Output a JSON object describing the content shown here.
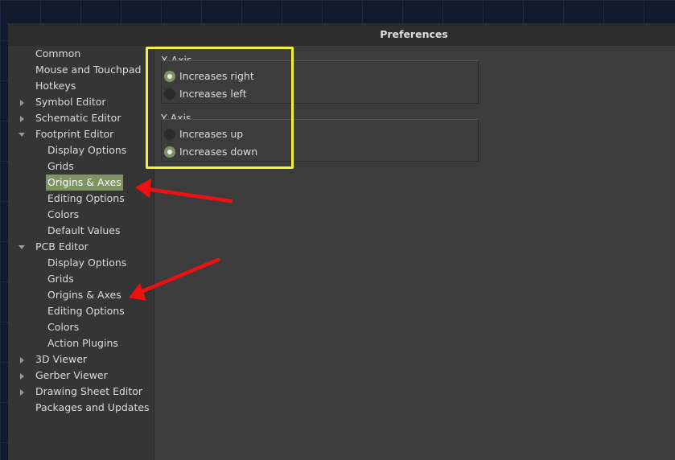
{
  "window": {
    "title": "Preferences"
  },
  "sidebar": {
    "items": [
      {
        "label": "Common",
        "level": 0,
        "expander": "none"
      },
      {
        "label": "Mouse and Touchpad",
        "level": 0,
        "expander": "none"
      },
      {
        "label": "Hotkeys",
        "level": 0,
        "expander": "none"
      },
      {
        "label": "Symbol Editor",
        "level": 0,
        "expander": "collapsed"
      },
      {
        "label": "Schematic Editor",
        "level": 0,
        "expander": "collapsed"
      },
      {
        "label": "Footprint Editor",
        "level": 0,
        "expander": "expanded"
      },
      {
        "label": "Display Options",
        "level": 1,
        "expander": "none"
      },
      {
        "label": "Grids",
        "level": 1,
        "expander": "none"
      },
      {
        "label": "Origins & Axes",
        "level": 1,
        "expander": "none",
        "selected": true
      },
      {
        "label": "Editing Options",
        "level": 1,
        "expander": "none"
      },
      {
        "label": "Colors",
        "level": 1,
        "expander": "none"
      },
      {
        "label": "Default Values",
        "level": 1,
        "expander": "none"
      },
      {
        "label": "PCB Editor",
        "level": 0,
        "expander": "expanded"
      },
      {
        "label": "Display Options",
        "level": 1,
        "expander": "none"
      },
      {
        "label": "Grids",
        "level": 1,
        "expander": "none"
      },
      {
        "label": "Origins & Axes",
        "level": 1,
        "expander": "none"
      },
      {
        "label": "Editing Options",
        "level": 1,
        "expander": "none"
      },
      {
        "label": "Colors",
        "level": 1,
        "expander": "none"
      },
      {
        "label": "Action Plugins",
        "level": 1,
        "expander": "none"
      },
      {
        "label": "3D Viewer",
        "level": 0,
        "expander": "collapsed"
      },
      {
        "label": "Gerber Viewer",
        "level": 0,
        "expander": "collapsed"
      },
      {
        "label": "Drawing Sheet Editor",
        "level": 0,
        "expander": "collapsed"
      },
      {
        "label": "Packages and Updates",
        "level": 0,
        "expander": "none"
      }
    ]
  },
  "x_axis": {
    "label": "X Axis",
    "options": [
      {
        "label": "Increases right",
        "checked": true
      },
      {
        "label": "Increases left",
        "checked": false
      }
    ]
  },
  "y_axis": {
    "label": "Y Axis",
    "options": [
      {
        "label": "Increases up",
        "checked": false
      },
      {
        "label": "Increases down",
        "checked": true
      }
    ]
  },
  "colors": {
    "highlight": "#f5f03a",
    "annotation_arrow": "#ee1111",
    "selection": "#7d9561"
  }
}
